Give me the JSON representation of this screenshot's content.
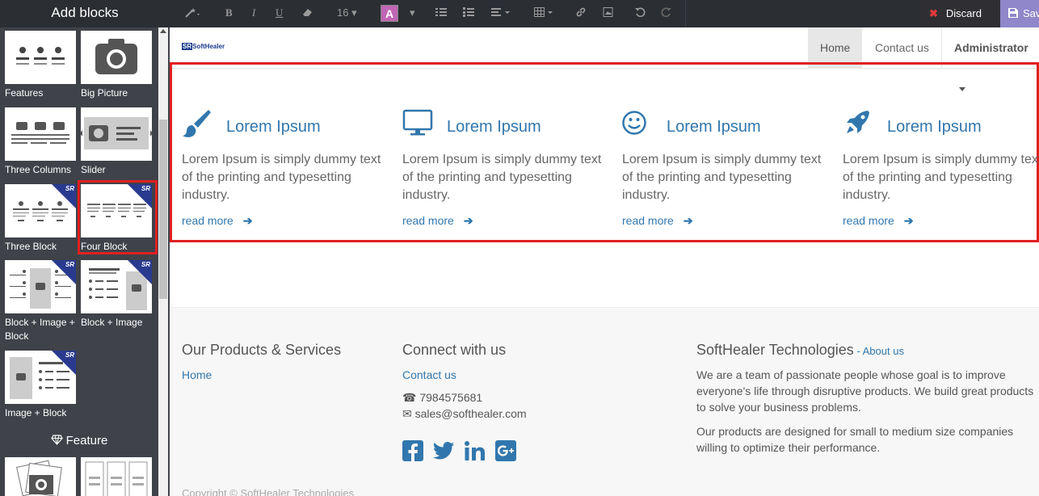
{
  "sidebar": {
    "title": "Add blocks",
    "blocks": [
      {
        "label": "Features"
      },
      {
        "label": "Big Picture"
      },
      {
        "label": "Three Columns"
      },
      {
        "label": "Slider"
      },
      {
        "label": "Three Block"
      },
      {
        "label": "Four Block"
      },
      {
        "label": "Block + Image + Block"
      },
      {
        "label": "Block + Image"
      },
      {
        "label": "Image + Block"
      }
    ],
    "section_title": "Feature",
    "badge_text": "SR"
  },
  "toolbar": {
    "font_size": "16",
    "color_button": "A",
    "discard_label": "Discard",
    "save_label": "Save"
  },
  "nav": {
    "logo": "SoftHealer",
    "items": [
      {
        "label": "Home"
      },
      {
        "label": "Contact us"
      },
      {
        "label": "Administrator"
      }
    ]
  },
  "features": [
    {
      "icon": "paint-brush-icon",
      "title": "Lorem Ipsum",
      "desc": "Lorem Ipsum is simply dummy text of the printing and typesetting industry.",
      "more": "read more"
    },
    {
      "icon": "desktop-icon",
      "title": "Lorem Ipsum",
      "desc": "Lorem Ipsum is simply dummy text of the printing and typesetting industry.",
      "more": "read more"
    },
    {
      "icon": "smile-icon",
      "title": "Lorem Ipsum",
      "desc": "Lorem Ipsum is simply dummy text of the printing and typesetting industry.",
      "more": "read more"
    },
    {
      "icon": "rocket-icon",
      "title": "Lorem Ipsum",
      "desc": "Lorem Ipsum is simply dummy text of the printing and typesetting industry.",
      "more": "read more"
    }
  ],
  "footer": {
    "products_title": "Our Products & Services",
    "products_link": "Home",
    "connect_title": "Connect with us",
    "connect_link": "Contact us",
    "phone": "7984575681",
    "email": "sales@softhealer.com",
    "company_title": "SoftHealer Technologies",
    "about_sep": " - ",
    "about_link": "About us",
    "company_text1": "We are a team of passionate people whose goal is to improve everyone's life through disruptive products. We build great products to solve your business problems.",
    "company_text2": "Our products are designed for small to medium size companies willing to optimize their performance.",
    "copyright": "Copyright © SoftHealer Technologies"
  },
  "colors": {
    "accent": "#3177ad",
    "highlight": "#e02020",
    "toolbar_bg": "#2b2e33",
    "sidebar_bg": "#3f4249",
    "save_bg": "#8f87c9"
  }
}
